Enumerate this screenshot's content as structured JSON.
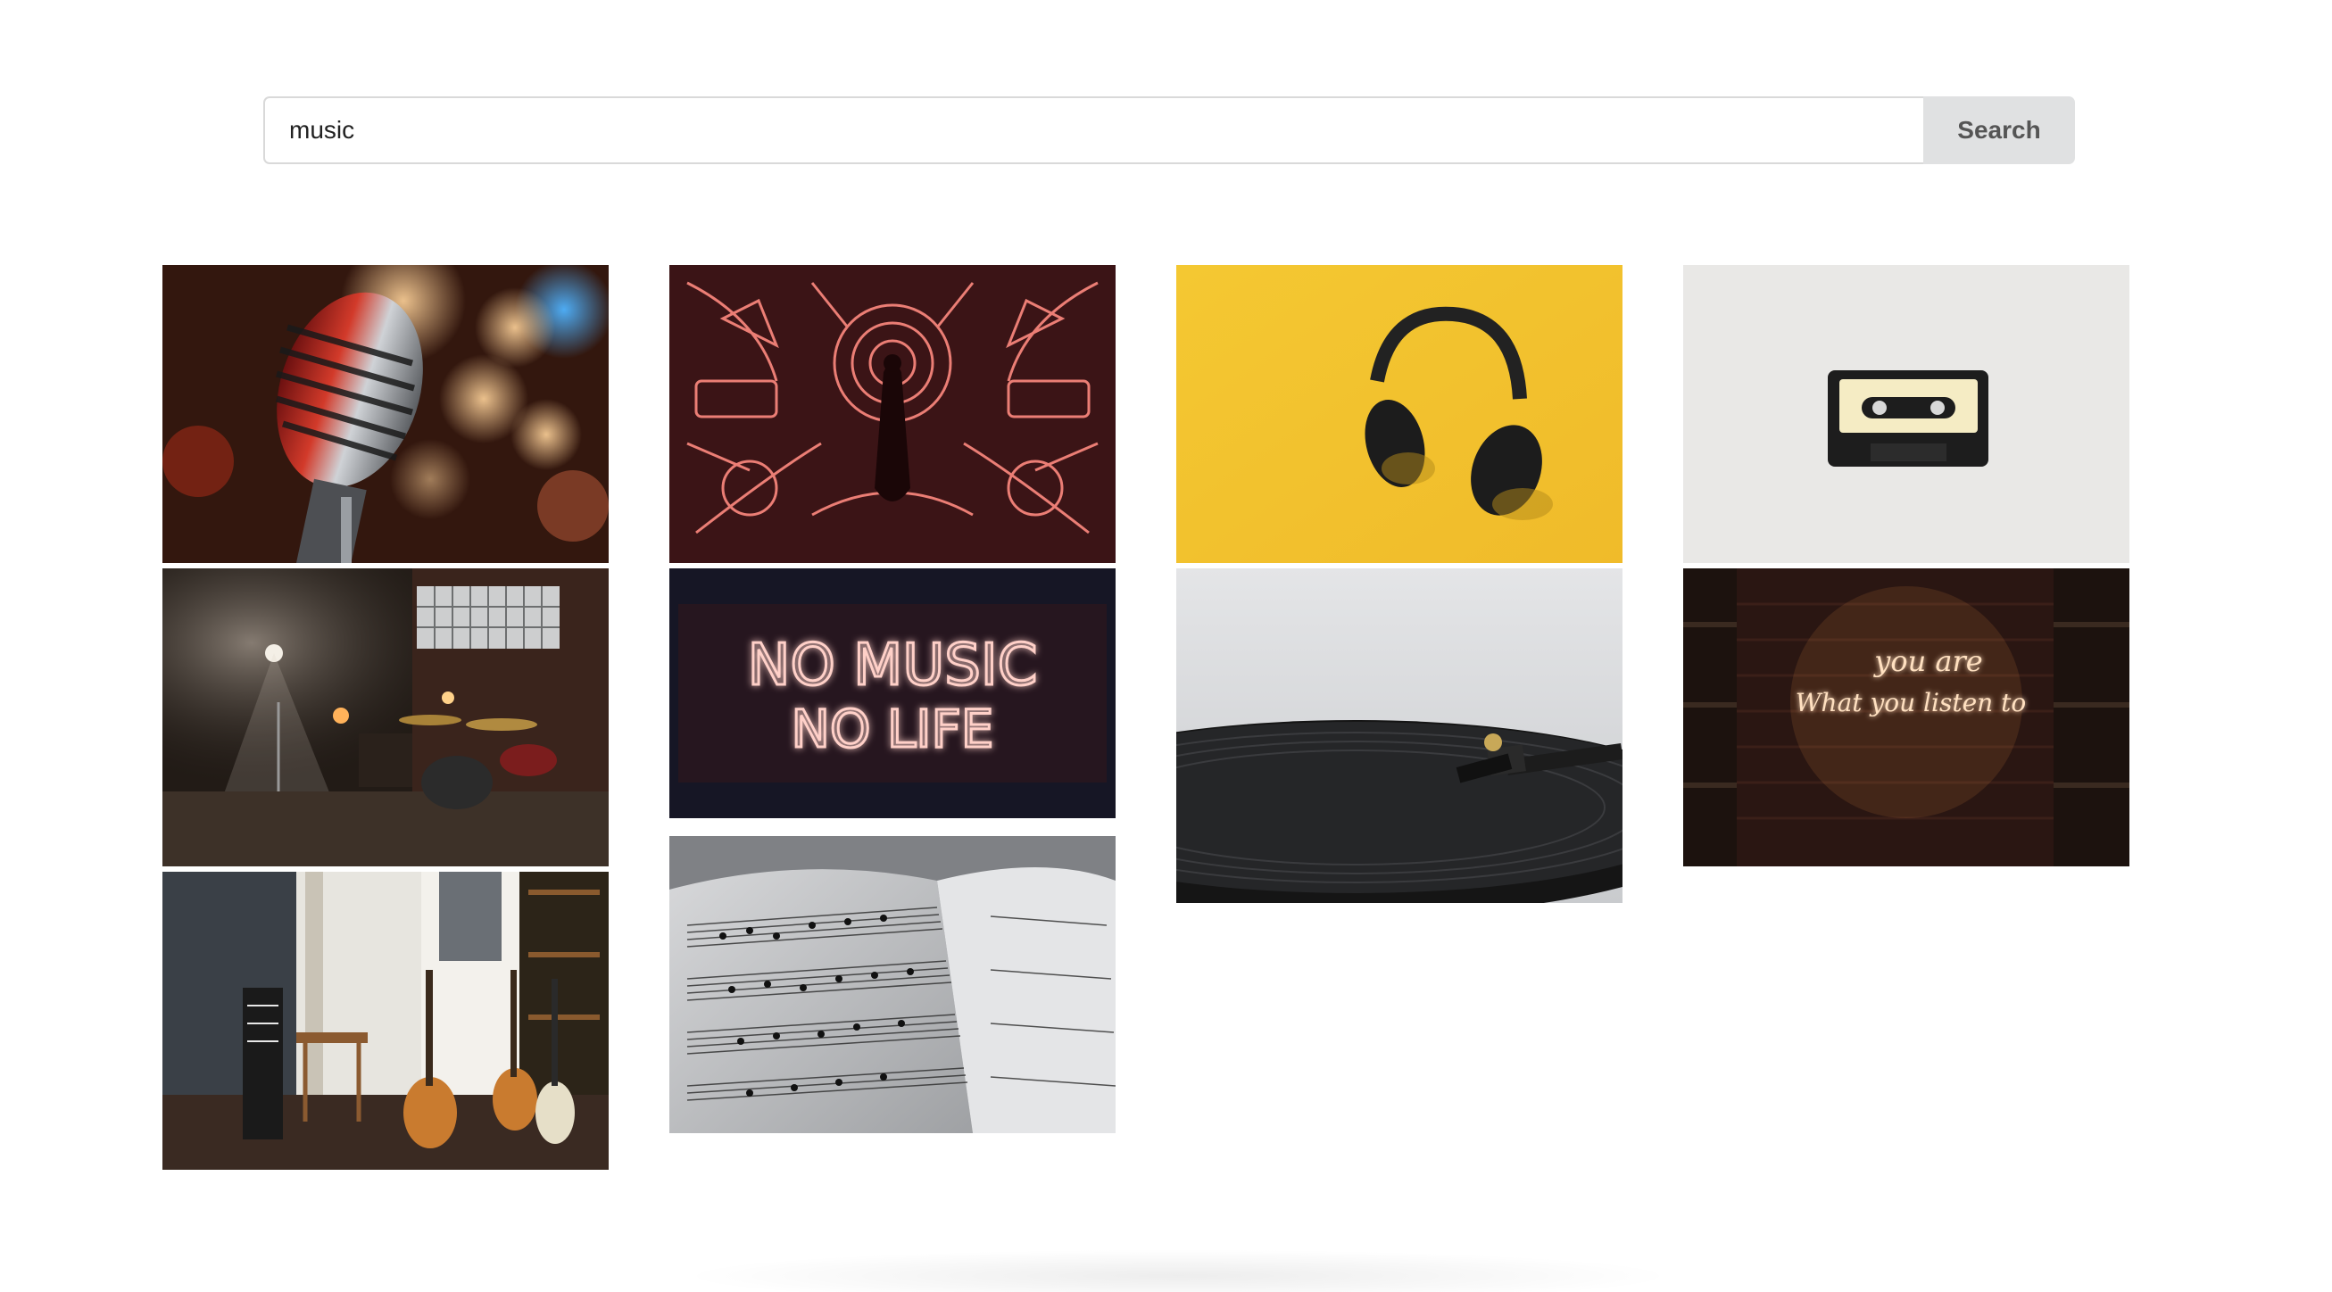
{
  "search": {
    "value": "music",
    "button_label": "Search"
  },
  "gallery": {
    "images": [
      {
        "subject": "vintage microphone with bokeh lights"
      },
      {
        "subject": "neon line-art music instruments around performer"
      },
      {
        "subject": "black headphones on yellow background"
      },
      {
        "subject": "cassette tape on white surface"
      },
      {
        "subject": "dark music studio with drum kit"
      },
      {
        "subject": "neon sign",
        "sign_text_line1": "NO MUSIC",
        "sign_text_line2": "NO LIFE"
      },
      {
        "subject": "vinyl record turntable"
      },
      {
        "subject": "neon sign on brick wall",
        "sign_text_line1": "you are",
        "sign_text_line2": "What you listen to"
      },
      {
        "subject": "home studio with guitars and keyboard"
      },
      {
        "subject": "sheet music book close-up"
      }
    ]
  },
  "colors": {
    "button_bg": "#e0e1e2",
    "input_border": "#d9d9d9"
  }
}
